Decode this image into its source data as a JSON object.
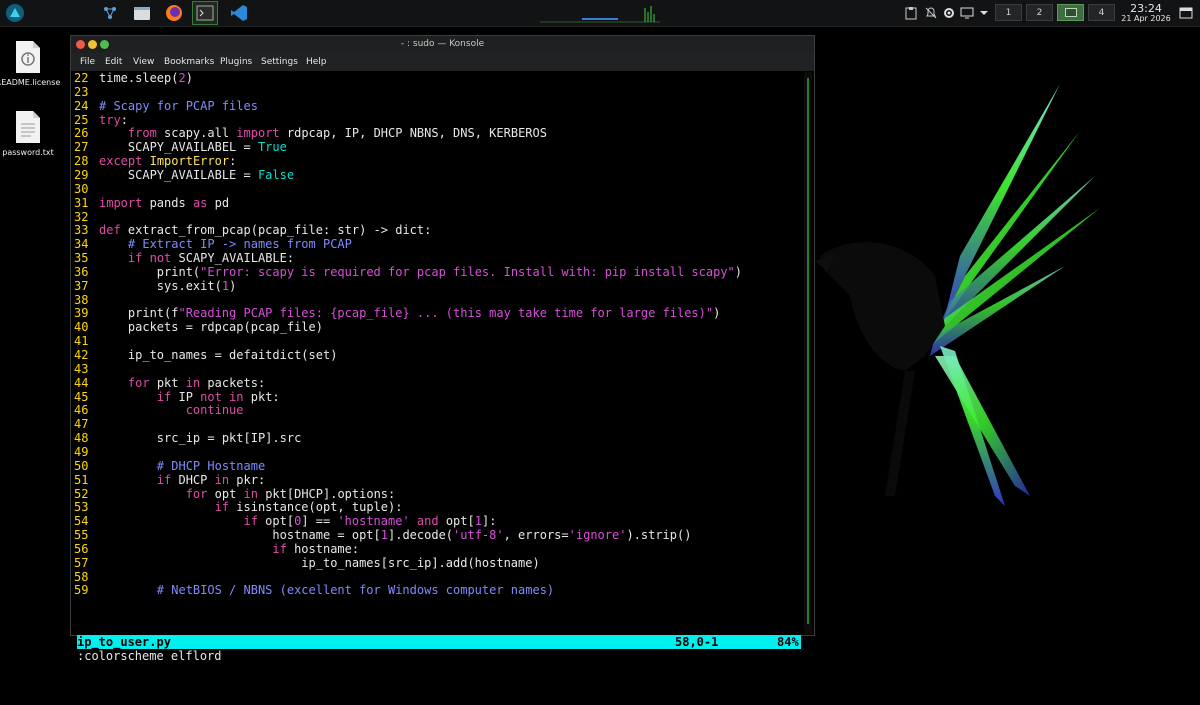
{
  "panel": {
    "launcher_icon": "parrot-launcher-icon",
    "tasks": [
      {
        "name": "network-icon"
      },
      {
        "name": "file-manager-icon"
      },
      {
        "name": "firefox-icon"
      },
      {
        "name": "terminal-icon"
      },
      {
        "name": "vscode-icon"
      }
    ],
    "desktops": [
      "1",
      "2",
      "3",
      "4"
    ],
    "active_desktop": 3,
    "clock": {
      "time": "23:24",
      "date": "21 Apr 2026"
    }
  },
  "desktop_icons": [
    {
      "label": "README.license",
      "icon": "info-file-icon"
    },
    {
      "label": "password.txt",
      "icon": "text-file-icon"
    }
  ],
  "window": {
    "title": "- : sudo — Konsole",
    "menu": [
      "File",
      "Edit",
      "View",
      "Bookmarks",
      "Plugins",
      "Settings",
      "Help"
    ]
  },
  "editor": {
    "lines": [
      {
        "n": "22",
        "text": "time.sleep(2)"
      },
      {
        "n": "23",
        "text": ""
      },
      {
        "n": "24",
        "text": "# Scapy for PCAP files"
      },
      {
        "n": "25",
        "text": "try:"
      },
      {
        "n": "26",
        "text": "    from scapy.all import rdpcap, IP, DHCP NBNS, DNS, KERBEROS"
      },
      {
        "n": "27",
        "text": "    SCAPY_AVAILABEL = True"
      },
      {
        "n": "28",
        "text": "except ImportError:"
      },
      {
        "n": "29",
        "text": "    SCAPY_AVAILABLE = False"
      },
      {
        "n": "30",
        "text": ""
      },
      {
        "n": "31",
        "text": "import pands as pd"
      },
      {
        "n": "32",
        "text": ""
      },
      {
        "n": "33",
        "text": "def extract_from_pcap(pcap_file: str) -> dict:"
      },
      {
        "n": "34",
        "text": "    # Extract IP -> names from PCAP"
      },
      {
        "n": "35",
        "text": "    if not SCAPY_AVAILABLE:"
      },
      {
        "n": "36",
        "text": "        print(\"Error: scapy is required for pcap files. Install with: pip install scapy\")"
      },
      {
        "n": "37",
        "text": "        sys.exit(1)"
      },
      {
        "n": "38",
        "text": ""
      },
      {
        "n": "39",
        "text": "    print(f\"Reading PCAP files: {pcap_file} ... (this may take time for large files)\")"
      },
      {
        "n": "40",
        "text": "    packets = rdpcap(pcap_file)"
      },
      {
        "n": "41",
        "text": ""
      },
      {
        "n": "42",
        "text": "    ip_to_names = defaitdict(set)"
      },
      {
        "n": "43",
        "text": ""
      },
      {
        "n": "44",
        "text": "    for pkt in packets:"
      },
      {
        "n": "45",
        "text": "        if IP not in pkt:"
      },
      {
        "n": "46",
        "text": "            continue"
      },
      {
        "n": "47",
        "text": ""
      },
      {
        "n": "48",
        "text": "        src_ip = pkt[IP].src"
      },
      {
        "n": "49",
        "text": ""
      },
      {
        "n": "50",
        "text": "        # DHCP Hostname"
      },
      {
        "n": "51",
        "text": "        if DHCP in pkr:"
      },
      {
        "n": "52",
        "text": "            for opt in pkt[DHCP].options:"
      },
      {
        "n": "53",
        "text": "                if isinstance(opt, tuple):"
      },
      {
        "n": "54",
        "text": "                    if opt[0] == 'hostname' and opt[1]:"
      },
      {
        "n": "55",
        "text": "                        hostname = opt[1].decode('utf-8', errors='ignore').strip()"
      },
      {
        "n": "56",
        "text": "                        if hostname:"
      },
      {
        "n": "57",
        "text": "                            ip_to_names[src_ip].add(hostname)"
      },
      {
        "n": "58",
        "text": ""
      },
      {
        "n": "59",
        "text": "        # NetBIOS / NBNS (excellent for Windows computer names)"
      }
    ],
    "status": {
      "file": "ip_to_user.py",
      "position": "58,0-1",
      "percent": "84%"
    },
    "command": ":colorscheme elflord"
  }
}
